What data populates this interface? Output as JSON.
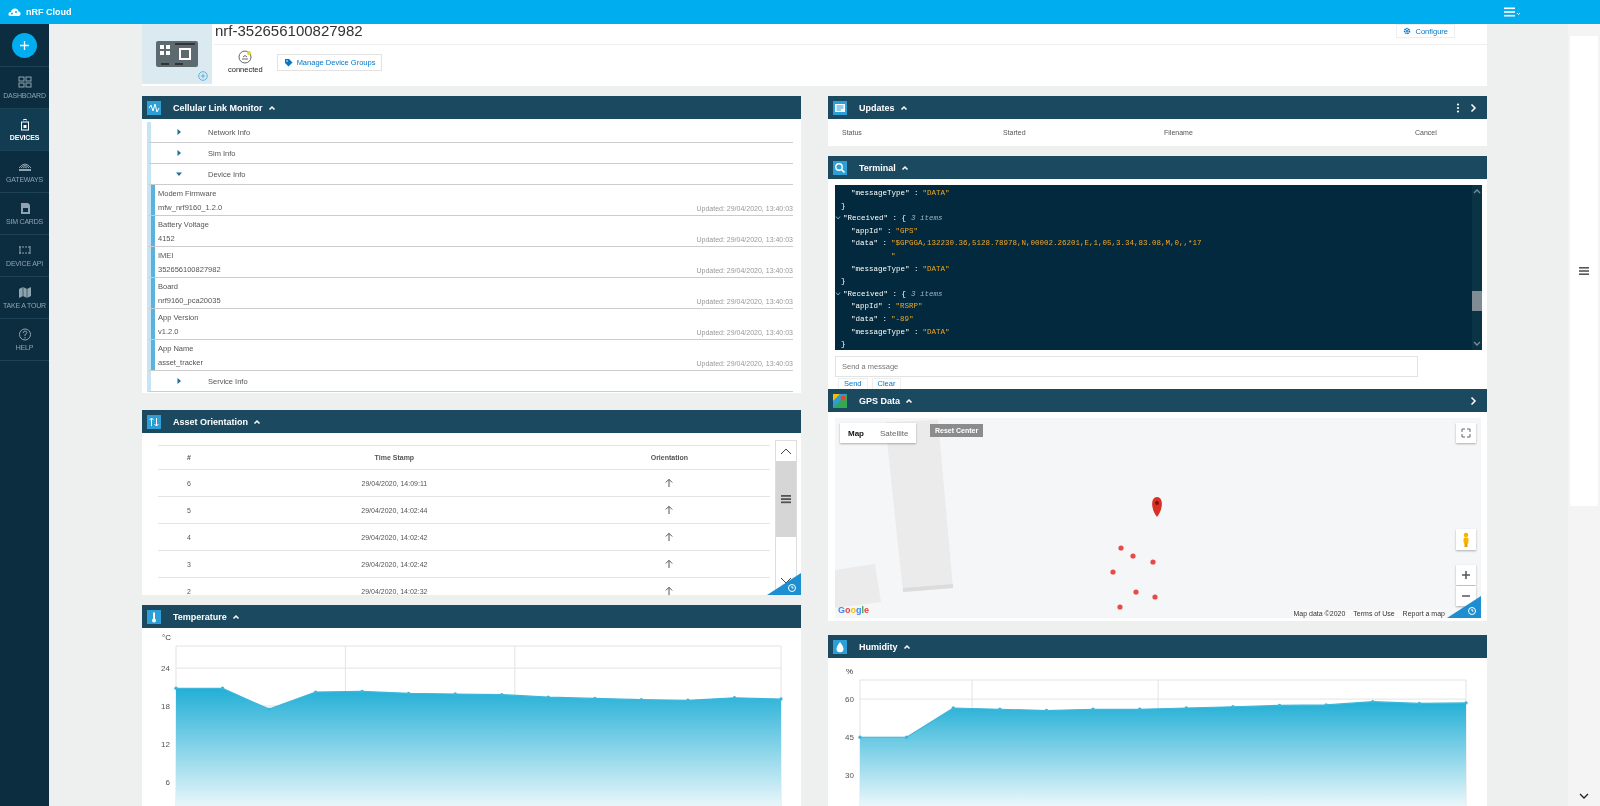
{
  "app": {
    "name": "nRF Cloud"
  },
  "sidebar": {
    "items": [
      {
        "label": "DASHBOARD",
        "selected": false
      },
      {
        "label": "DEVICES",
        "selected": true
      },
      {
        "label": "GATEWAYS",
        "selected": false
      },
      {
        "label": "SIM CARDS",
        "selected": false
      },
      {
        "label": "DEVICE API",
        "selected": false
      },
      {
        "label": "TAKE A TOUR",
        "selected": false
      },
      {
        "label": "HELP",
        "selected": false
      }
    ]
  },
  "device": {
    "name": "nrf-352656100827982",
    "status": "connected",
    "manage_groups": "Manage Device Groups",
    "configure": "Configure"
  },
  "cellular_link_monitor": {
    "title": "Cellular Link Monitor",
    "expanded": true,
    "sections": [
      {
        "title": "Network Info",
        "expanded": false
      },
      {
        "title": "Sim Info",
        "expanded": false
      },
      {
        "title": "Device Info",
        "expanded": true,
        "children": [
          {
            "label": "Modem Firmware",
            "value": "mfw_nrf9160_1.2.0",
            "updated": "Updated: 29/04/2020, 13:40:03"
          },
          {
            "label": "Battery Voltage",
            "value": "4152",
            "updated": "Updated: 29/04/2020, 13:40:03"
          },
          {
            "label": "IMEI",
            "value": "352656100827982",
            "updated": "Updated: 29/04/2020, 13:40:03"
          },
          {
            "label": "Board",
            "value": "nrf9160_pca20035",
            "updated": "Updated: 29/04/2020, 13:40:03"
          },
          {
            "label": "App Version",
            "value": "v1.2.0",
            "updated": "Updated: 29/04/2020, 13:40:03"
          },
          {
            "label": "App Name",
            "value": "asset_tracker",
            "updated": "Updated: 29/04/2020, 13:40:03"
          }
        ]
      },
      {
        "title": "Service Info",
        "expanded": false
      }
    ]
  },
  "asset_orientation": {
    "title": "Asset Orientation",
    "expanded": true,
    "columns": [
      "#",
      "Time Stamp",
      "Orientation"
    ],
    "rows": [
      {
        "index": "6",
        "timestamp": "29/04/2020, 14:09:11"
      },
      {
        "index": "5",
        "timestamp": "29/04/2020, 14:02:44"
      },
      {
        "index": "4",
        "timestamp": "29/04/2020, 14:02:42"
      },
      {
        "index": "3",
        "timestamp": "29/04/2020, 14:02:42"
      },
      {
        "index": "2",
        "timestamp": "29/04/2020, 14:02:32"
      }
    ]
  },
  "temperature": {
    "title": "Temperature",
    "expanded": true,
    "chart_data": {
      "type": "area",
      "ylabel": "°C",
      "categories": [
        null,
        null,
        null,
        null,
        null,
        null,
        null,
        null,
        null,
        null,
        null,
        null,
        null,
        null
      ],
      "values": [
        20.8,
        20.8,
        17.5,
        20.2,
        20.3,
        20.0,
        19.9,
        19.8,
        19.4,
        19.2,
        19.0,
        18.9,
        19.3,
        19.1
      ],
      "ylim": [
        2,
        27.5
      ],
      "yticks": [
        6,
        12,
        18,
        24
      ]
    }
  },
  "updates": {
    "title": "Updates",
    "expanded": true,
    "columns": [
      "Status",
      "Started",
      "Filename",
      "Cancel"
    ]
  },
  "terminal": {
    "title": "Terminal",
    "expanded": true,
    "blocks": [
      {
        "pairs": [
          {
            "key": "\"messageType\" :",
            "value": "\"DATA\""
          }
        ],
        "close": "}"
      },
      {
        "key": "\"Received\" : {",
        "note": "3 items",
        "expanded": true,
        "pairs": [
          {
            "key": "\"appId\" :",
            "value": "\"GPS\""
          },
          {
            "key": "\"data\" :",
            "value": "\"$GPGGA,132230.36,5128.78978,N,00002.26201,E,1,05,3.34,83.08,M,0,,*17",
            "wrap": "\""
          },
          {
            "key": "\"messageType\" :",
            "value": "\"DATA\""
          }
        ],
        "close": "}"
      },
      {
        "key": "\"Received\" : {",
        "note": "3 items",
        "expanded": true,
        "pairs": [
          {
            "key": "\"appId\" :",
            "value": "\"RSRP\""
          },
          {
            "key": "\"data\" :",
            "value": "\"-89\""
          },
          {
            "key": "\"messageType\" :",
            "value": "\"DATA\""
          }
        ],
        "close": "}"
      }
    ],
    "input": {
      "placeholder": "Send a message"
    },
    "buttons": [
      "Send",
      "Clear"
    ]
  },
  "gps": {
    "title": "GPS Data",
    "expanded": true,
    "map_types": [
      {
        "label": "Map",
        "selected": true
      },
      {
        "label": "Satellite",
        "selected": false
      }
    ],
    "reset": "Reset Center",
    "logo": "Google",
    "footer": [
      "Map data ©2020",
      "Terms of Use",
      "Report a map"
    ]
  },
  "humidity": {
    "title": "Humidity",
    "expanded": true,
    "chart_data": {
      "type": "area",
      "ylabel": "%",
      "categories": [
        null,
        null,
        null,
        null,
        null,
        null,
        null,
        null,
        null,
        null,
        null,
        null,
        null,
        null
      ],
      "values": [
        45,
        45,
        56.5,
        56,
        55.5,
        56,
        56,
        56.5,
        57,
        57.5,
        57.7,
        59,
        58.3,
        58.5
      ],
      "ylim": [
        18,
        67.5
      ],
      "yticks": [
        30,
        45,
        60
      ]
    }
  }
}
